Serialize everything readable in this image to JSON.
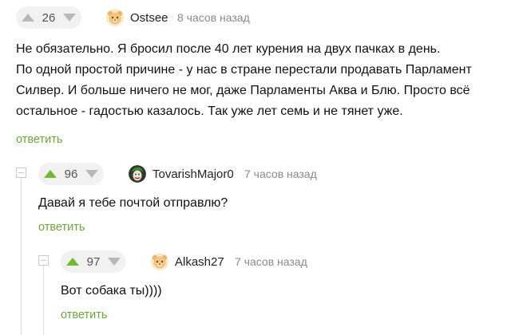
{
  "comments": [
    {
      "votes": "26",
      "author": "Ostsee",
      "time": "8 часов назад",
      "text": "Не обязательно. Я бросил после 40 лет курения на двух пачках в день.\nПо одной простой причине - у нас в стране перестали продавать Парламент\nСилвер. И больше ничего не мог, даже Парламенты Аква и Блю. Просто всё\nостальное - гадостью казалось. Так уже лет семь и не тянет уже.",
      "reply_label": "ответить",
      "avatar_icon": "bear-avatar-icon",
      "upvote_color": "#b8b8b8"
    },
    {
      "votes": "96",
      "author": "TovarishMajor0",
      "time": "7 часов назад",
      "text": "Давай я тебе почтой отправлю?",
      "reply_label": "ответить",
      "avatar_icon": "joker-avatar-icon",
      "upvote_color": "#72b932"
    },
    {
      "votes": "97",
      "author": "Alkash27",
      "time": "7 часов назад",
      "text": "Вот собака ты))))",
      "reply_label": "ответить",
      "avatar_icon": "bear-avatar-icon",
      "upvote_color": "#72b932"
    }
  ],
  "colors": {
    "reply_link": "#6ea63e",
    "upvote_active": "#72b932",
    "vote_inactive": "#b8b8b8",
    "vote_bg": "#f1f1f1",
    "time": "#8a8a8a",
    "thread_line": "#dcdcdc"
  }
}
